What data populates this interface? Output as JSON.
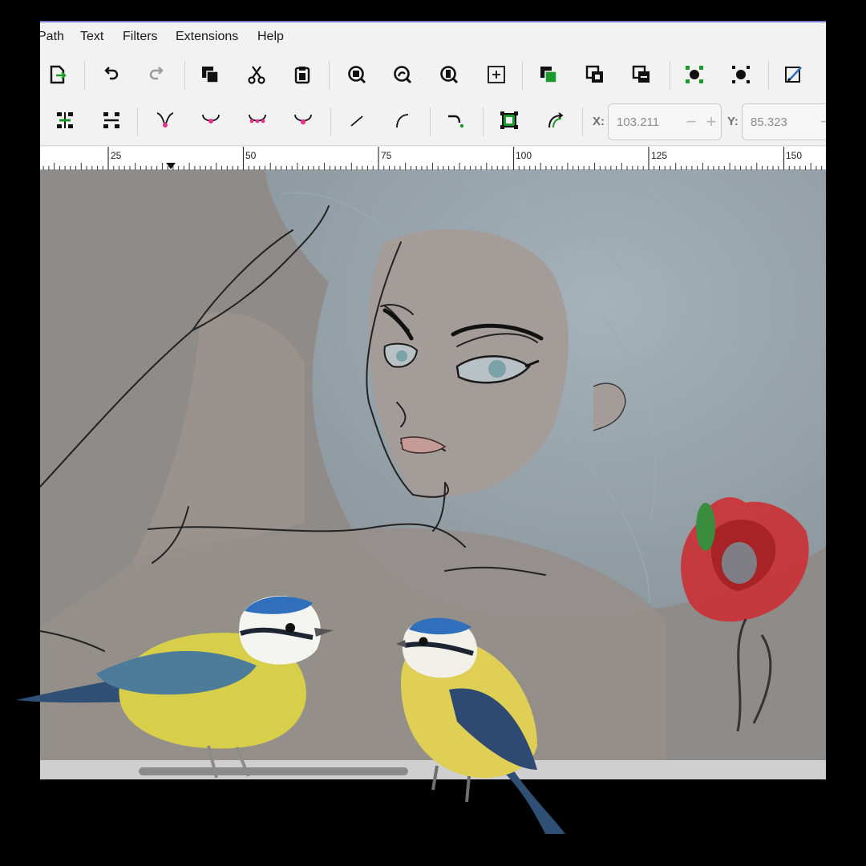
{
  "menu": {
    "items": [
      "Path",
      "Text",
      "Filters",
      "Extensions",
      "Help"
    ]
  },
  "toolbar1": {
    "icons": [
      "export-icon",
      "undo-icon",
      "redo-icon",
      "duplicate-icon",
      "cut-icon",
      "paste-icon",
      "zoom-selection-icon",
      "zoom-drawing-icon",
      "zoom-page-icon",
      "zoom-center-icon",
      "group-icon",
      "ungroup-icon",
      "clone-icon",
      "node-snap-icon",
      "bbox-snap-icon",
      "fill-stroke-icon"
    ]
  },
  "toolbar2": {
    "icons": [
      "insert-node-icon",
      "delete-node-icon",
      "cusp-node-icon",
      "smooth-node-icon",
      "symmetric-node-icon",
      "auto-node-icon",
      "straight-segment-icon",
      "curve-segment-icon",
      "break-path-icon",
      "object-to-path-icon",
      "stroke-to-path-icon"
    ]
  },
  "coords": {
    "x_label": "X:",
    "x_value": "103.211",
    "y_label": "Y:",
    "y_value": "85.323"
  },
  "ruler": {
    "labels": [
      "25",
      "50",
      "75",
      "100",
      "125",
      "150"
    ]
  },
  "colors": {
    "menubar_bg": "#f2f2f2",
    "canvas_bg": "#8f8b88",
    "node_handle": "#e8318a",
    "snap_green": "#1a9a2a",
    "window_border": "#7b7bd6"
  }
}
